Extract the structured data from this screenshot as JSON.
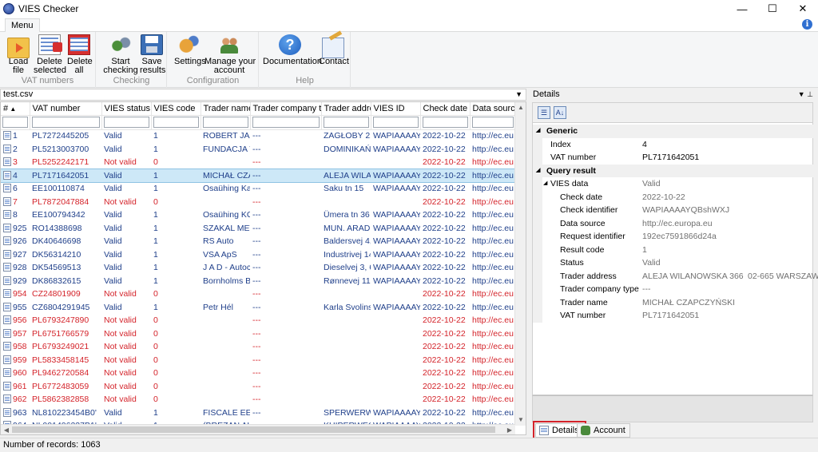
{
  "window": {
    "title": "VIES Checker",
    "minimize": "—",
    "maximize": "☐",
    "close": "✕"
  },
  "menu": {
    "tab_label": "Menu",
    "info_icon": "i"
  },
  "ribbon": {
    "groups": [
      {
        "label": "VAT numbers",
        "buttons": [
          {
            "label": "Load\nfile",
            "icon": "folder-icon"
          },
          {
            "label": "Delete\nselected",
            "icon": "delete-selected-icon"
          },
          {
            "label": "Delete\nall",
            "icon": "delete-all-icon"
          }
        ]
      },
      {
        "label": "Checking",
        "buttons": [
          {
            "label": "Start\nchecking",
            "icon": "start-checking-icon"
          },
          {
            "label": "Save\nresults",
            "icon": "floppy-icon"
          }
        ]
      },
      {
        "label": "Configuration",
        "buttons": [
          {
            "label": "Settings",
            "icon": "gears-icon"
          },
          {
            "label": "Manage your\naccount",
            "icon": "people-icon"
          }
        ]
      },
      {
        "label": "Help",
        "buttons": [
          {
            "label": "Documentation",
            "icon": "help-icon"
          },
          {
            "label": "Contact",
            "icon": "mail-icon"
          }
        ]
      }
    ]
  },
  "file": {
    "name": "test.csv"
  },
  "grid": {
    "columns": [
      "#",
      "VAT number",
      "VIES status",
      "VIES code",
      "Trader name",
      "Trader company type",
      "Trader address",
      "VIES ID",
      "Check date",
      "Data source"
    ],
    "rows": [
      {
        "n": "1",
        "vat": "PL7272445205",
        "status": "Valid",
        "code": "1",
        "name": "ROBERT JAZ(",
        "tc": "---",
        "addr": "ZAGŁOBY 21",
        "vid": "WAPIAAAAY(",
        "date": "2022-10-22",
        "src": "http://ec.eu",
        "invalid": false
      },
      {
        "n": "2",
        "vat": "PL5213003700",
        "status": "Valid",
        "code": "1",
        "name": "FUNDACJA V",
        "tc": "---",
        "addr": "DOMINIKAŃ",
        "vid": "WAPIAAAAY(",
        "date": "2022-10-22",
        "src": "http://ec.eu",
        "invalid": false
      },
      {
        "n": "3",
        "vat": "PL5252242171",
        "status": "Not valid",
        "code": "0",
        "name": "",
        "tc": "---",
        "addr": "",
        "vid": "",
        "date": "2022-10-22",
        "src": "http://ec.eu",
        "invalid": true
      },
      {
        "n": "4",
        "vat": "PL7171642051",
        "status": "Valid",
        "code": "1",
        "name": "MICHAŁ CZA",
        "tc": "---",
        "addr": "ALEJA WILAN",
        "vid": "WAPIAAAAY(",
        "date": "2022-10-22",
        "src": "http://ec.eu",
        "invalid": false,
        "selected": true
      },
      {
        "n": "6",
        "vat": "EE100110874",
        "status": "Valid",
        "code": "1",
        "name": "Osaühing Ka",
        "tc": "---",
        "addr": "Saku tn 15",
        "vid": "WAPIAAAAY(",
        "date": "2022-10-22",
        "src": "http://ec.eu",
        "invalid": false
      },
      {
        "n": "7",
        "vat": "PL7872047884",
        "status": "Not valid",
        "code": "0",
        "name": "",
        "tc": "---",
        "addr": "",
        "vid": "",
        "date": "2022-10-22",
        "src": "http://ec.eu",
        "invalid": true
      },
      {
        "n": "8",
        "vat": "EE100794342",
        "status": "Valid",
        "code": "1",
        "name": "Osaühing KC",
        "tc": "---",
        "addr": "Ümera tn 36",
        "vid": "WAPIAAAAY(",
        "date": "2022-10-22",
        "src": "http://ec.eu",
        "invalid": false
      },
      {
        "n": "925",
        "vat": "RO14388698",
        "status": "Valid",
        "code": "1",
        "name": "SZAKAL MET",
        "tc": "---",
        "addr": "MUN. ARAD,",
        "vid": "WAPIAAAAY(",
        "date": "2022-10-22",
        "src": "http://ec.eu",
        "invalid": false
      },
      {
        "n": "926",
        "vat": "DK40646698",
        "status": "Valid",
        "code": "1",
        "name": "RS Auto",
        "tc": "---",
        "addr": "Baldersvej 4,",
        "vid": "WAPIAAAAY(",
        "date": "2022-10-22",
        "src": "http://ec.eu",
        "invalid": false
      },
      {
        "n": "927",
        "vat": "DK56314210",
        "status": "Valid",
        "code": "1",
        "name": "VSA ApS",
        "tc": "---",
        "addr": "Industrivej 14",
        "vid": "WAPIAAAAY(",
        "date": "2022-10-22",
        "src": "http://ec.eu",
        "invalid": false
      },
      {
        "n": "928",
        "vat": "DK54569513",
        "status": "Valid",
        "code": "1",
        "name": "J A D - Autoc",
        "tc": "---",
        "addr": "Dieselvej 3, 6",
        "vid": "WAPIAAAAY(",
        "date": "2022-10-22",
        "src": "http://ec.eu",
        "invalid": false
      },
      {
        "n": "929",
        "vat": "DK86832615",
        "status": "Valid",
        "code": "1",
        "name": "Bornholms B",
        "tc": "---",
        "addr": "Rønnevej 11'",
        "vid": "WAPIAAAAY(",
        "date": "2022-10-22",
        "src": "http://ec.eu",
        "invalid": false
      },
      {
        "n": "954",
        "vat": "CZ24801909",
        "status": "Not valid",
        "code": "0",
        "name": "",
        "tc": "---",
        "addr": "",
        "vid": "",
        "date": "2022-10-22",
        "src": "http://ec.eu",
        "invalid": true
      },
      {
        "n": "955",
        "vat": "CZ6804291945",
        "status": "Valid",
        "code": "1",
        "name": "Petr Hél",
        "tc": "---",
        "addr": "Karla Svolinsl",
        "vid": "WAPIAAAAY(",
        "date": "2022-10-22",
        "src": "http://ec.eu",
        "invalid": false
      },
      {
        "n": "956",
        "vat": "PL6793247890",
        "status": "Not valid",
        "code": "0",
        "name": "",
        "tc": "---",
        "addr": "",
        "vid": "",
        "date": "2022-10-22",
        "src": "http://ec.eu",
        "invalid": true
      },
      {
        "n": "957",
        "vat": "PL6751766579",
        "status": "Not valid",
        "code": "0",
        "name": "",
        "tc": "---",
        "addr": "",
        "vid": "",
        "date": "2022-10-22",
        "src": "http://ec.eu",
        "invalid": true
      },
      {
        "n": "958",
        "vat": "PL6793249021",
        "status": "Not valid",
        "code": "0",
        "name": "",
        "tc": "---",
        "addr": "",
        "vid": "",
        "date": "2022-10-22",
        "src": "http://ec.eu",
        "invalid": true
      },
      {
        "n": "959",
        "vat": "PL5833458145",
        "status": "Not valid",
        "code": "0",
        "name": "",
        "tc": "---",
        "addr": "",
        "vid": "",
        "date": "2022-10-22",
        "src": "http://ec.eu",
        "invalid": true
      },
      {
        "n": "960",
        "vat": "PL9462720584",
        "status": "Not valid",
        "code": "0",
        "name": "",
        "tc": "---",
        "addr": "",
        "vid": "",
        "date": "2022-10-22",
        "src": "http://ec.eu",
        "invalid": true
      },
      {
        "n": "961",
        "vat": "PL6772483059",
        "status": "Not valid",
        "code": "0",
        "name": "",
        "tc": "---",
        "addr": "",
        "vid": "",
        "date": "2022-10-22",
        "src": "http://ec.eu",
        "invalid": true
      },
      {
        "n": "962",
        "vat": "PL5862382858",
        "status": "Not valid",
        "code": "0",
        "name": "",
        "tc": "---",
        "addr": "",
        "vid": "",
        "date": "2022-10-22",
        "src": "http://ec.eu",
        "invalid": true
      },
      {
        "n": "963",
        "vat": "NL810223454B0'",
        "status": "Valid",
        "code": "1",
        "name": "FISCALE EEN",
        "tc": "---",
        "addr": "SPERWERWE",
        "vid": "WAPIAAAAY(",
        "date": "2022-10-22",
        "src": "http://ec.eu",
        "invalid": false
      },
      {
        "n": "964",
        "vat": "NL001406237B1'",
        "status": "Valid",
        "code": "1",
        "name": "(BREZAN ALI",
        "tc": "---",
        "addr": "KUIPERWEG",
        "vid": "WAPIAAAAY(",
        "date": "2022-10-22",
        "src": "http://ec.eu",
        "invalid": false
      }
    ]
  },
  "details": {
    "title": "Details",
    "categories": [
      {
        "label": "Generic",
        "props": [
          {
            "k": "Index",
            "v": "4"
          },
          {
            "k": "VAT number",
            "v": "PL7171642051"
          }
        ]
      },
      {
        "label": "Query result",
        "props": []
      }
    ],
    "vies_data": {
      "k": "VIES data",
      "v": "Valid"
    },
    "vies_props": [
      {
        "k": "Check date",
        "v": "2022-10-22"
      },
      {
        "k": "Check identifier",
        "v": "WAPIAAAAYQBshWXJ"
      },
      {
        "k": "Data source",
        "v": "http://ec.europa.eu"
      },
      {
        "k": "Request identifier",
        "v": "192ec7591866d24a"
      },
      {
        "k": "Result code",
        "v": "1"
      },
      {
        "k": "Status",
        "v": "Valid"
      },
      {
        "k": "Trader address",
        "v": "ALEJA WILANOWSKA 366",
        "v2": "02-665 WARSZAWA"
      },
      {
        "k": "Trader company type",
        "v": "---"
      },
      {
        "k": "Trader name",
        "v": "MICHAŁ CZAPCZYŃSKI"
      },
      {
        "k": "VAT number",
        "v": "PL7171642051"
      }
    ]
  },
  "bottom_tabs": {
    "details": "Details",
    "account": "Account"
  },
  "status": {
    "text": "Number of records: 1063"
  }
}
